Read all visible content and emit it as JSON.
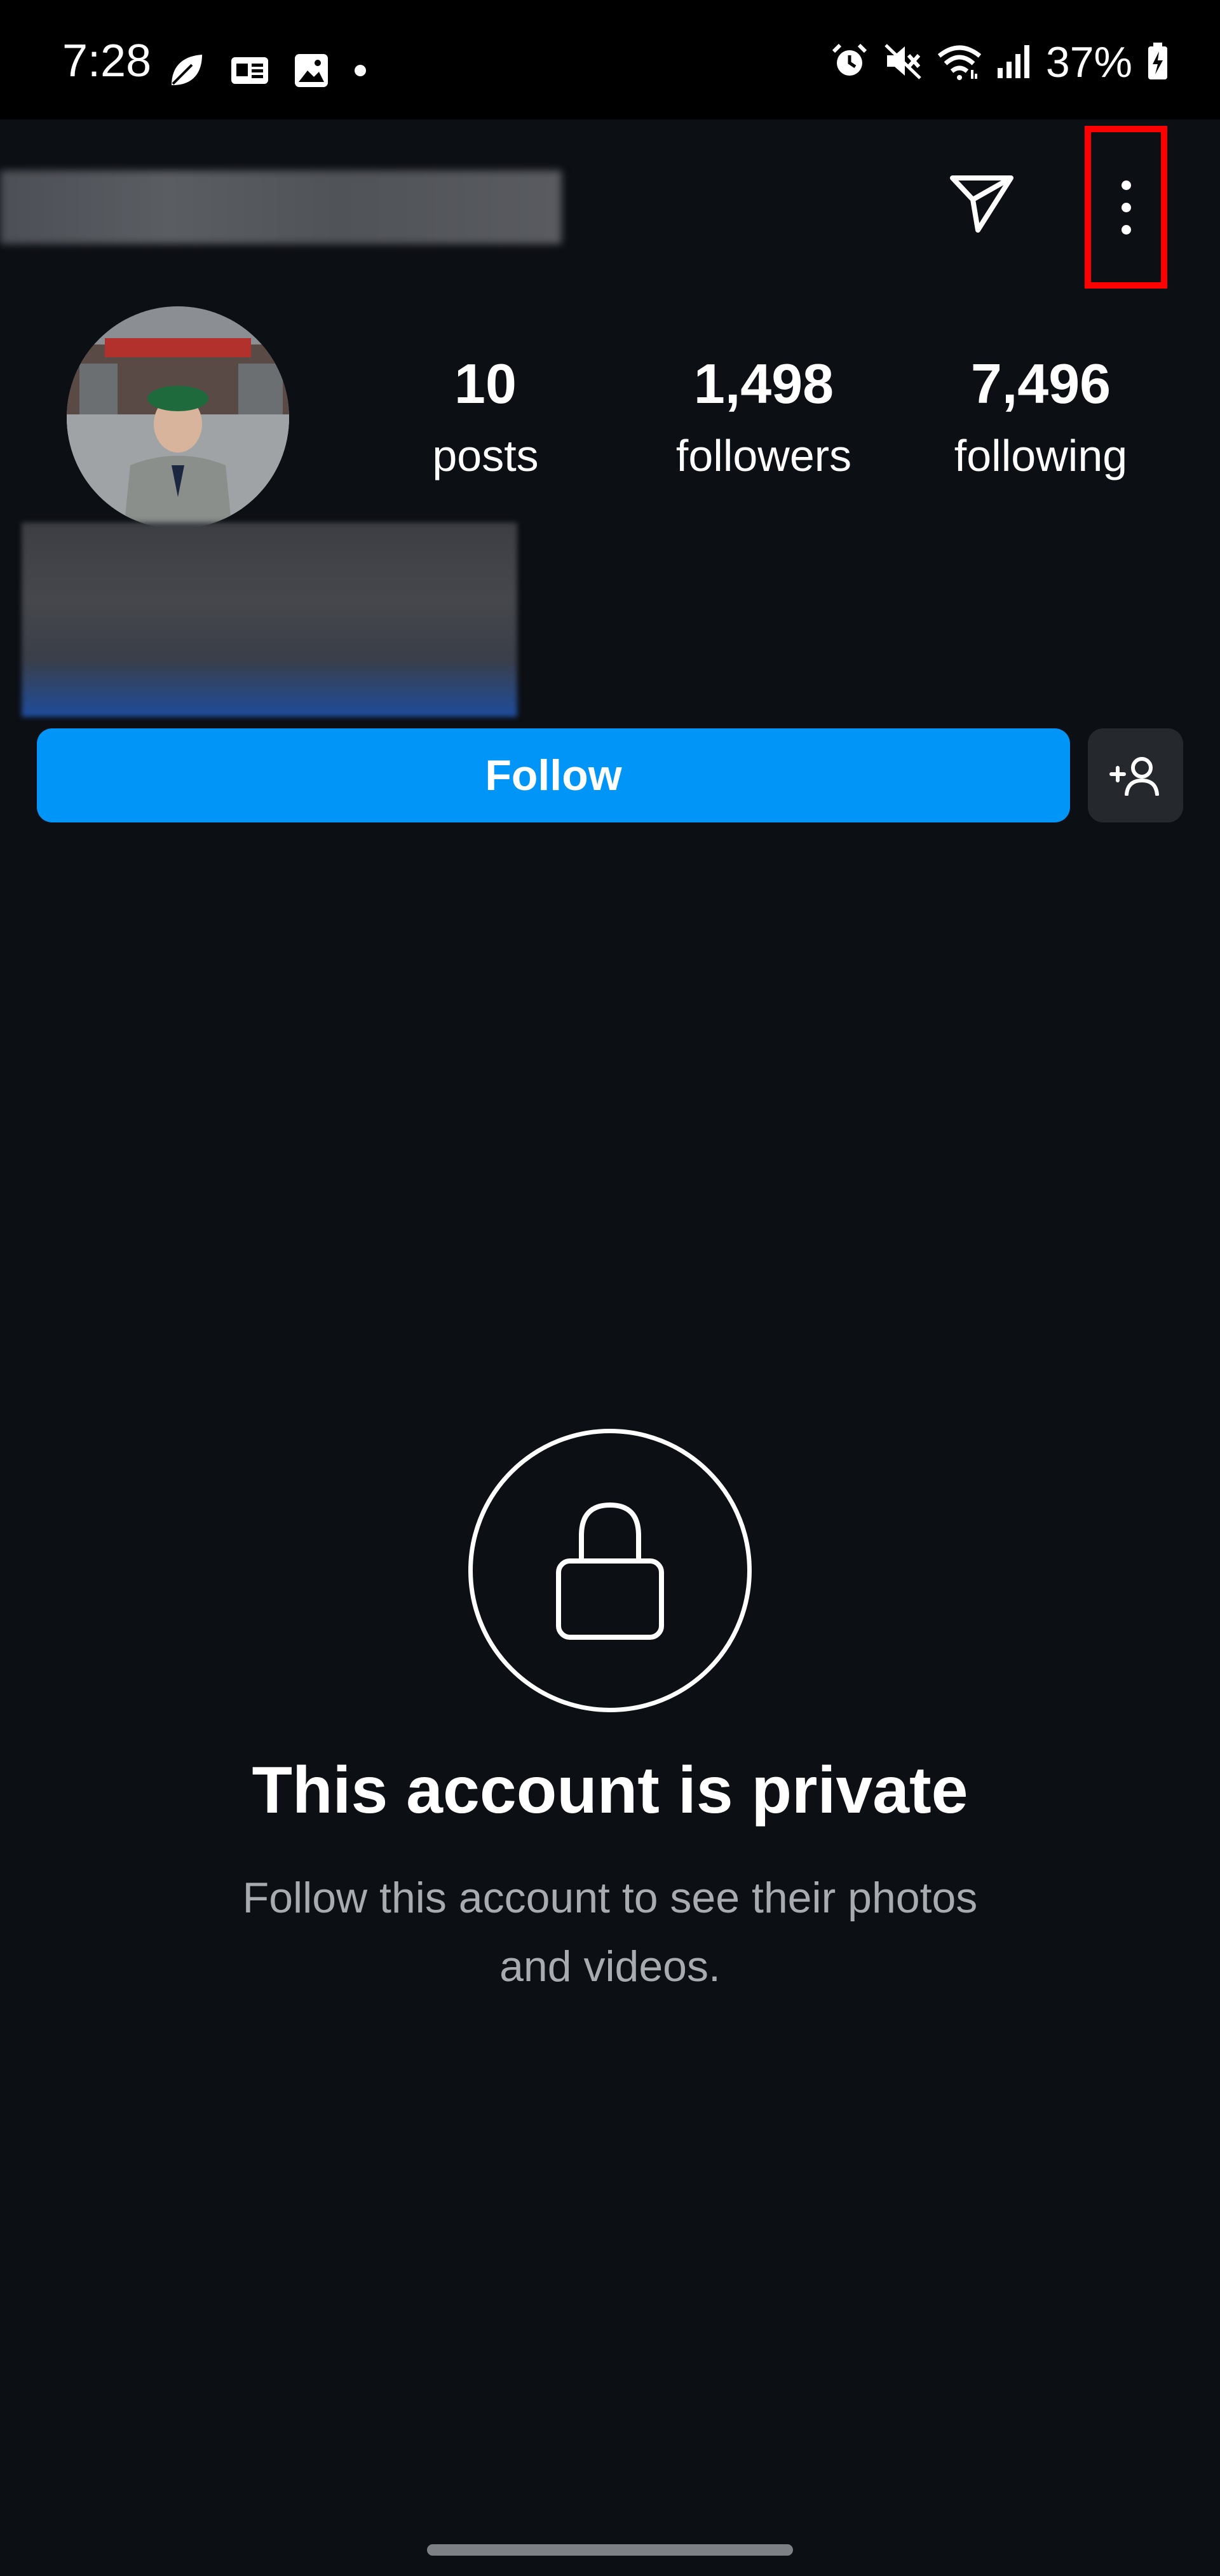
{
  "status_bar": {
    "time": "7:28",
    "left_icons": [
      "leaf-icon",
      "news-icon",
      "gallery-icon",
      "dot-icon"
    ],
    "right_icons": [
      "alarm-icon",
      "mute-icon",
      "wifi-icon",
      "signal-icon"
    ],
    "battery": "37%"
  },
  "header": {
    "send_icon": "paper-plane-icon",
    "more_icon": "more-vertical-icon"
  },
  "profile": {
    "stats": [
      {
        "value": "10",
        "label": "posts"
      },
      {
        "value": "1,498",
        "label": "followers"
      },
      {
        "value": "7,496",
        "label": "following"
      }
    ],
    "follow_label": "Follow",
    "suggest_icon": "add-person-icon"
  },
  "private": {
    "title": "This account is private",
    "subtitle_line1": "Follow this account to see their photos",
    "subtitle_line2": "and videos."
  },
  "colors": {
    "background": "#0c0f14",
    "accent": "#0095f6",
    "highlight": "#ff0000"
  }
}
